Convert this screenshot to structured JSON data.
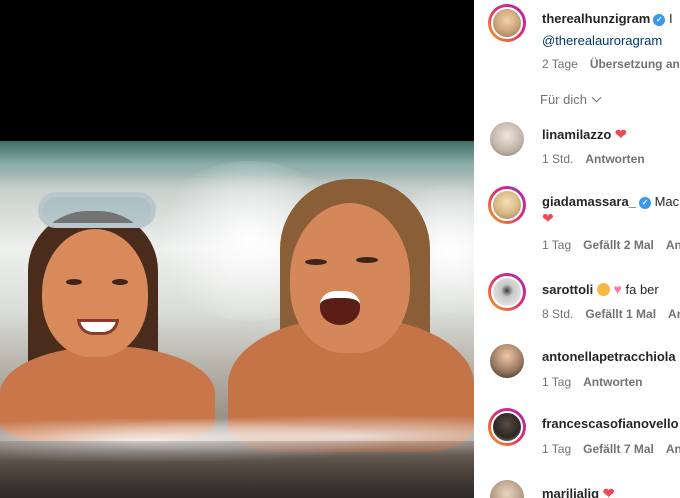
{
  "post": {
    "author": "therealhunzigram",
    "caption_cut": "I",
    "mention": "@therealauroragram",
    "time": "2 Tage",
    "translation": "Übersetzung anz"
  },
  "sort": {
    "label": "Für dich"
  },
  "comments": [
    {
      "username": "linamilazzo",
      "text": "",
      "heart": "❤",
      "time": "1 Std.",
      "likes": "",
      "reply": "Antworten"
    },
    {
      "username": "giadamassara_",
      "text": "Mac",
      "heart": "❤",
      "time": "1 Tag",
      "likes": "Gefällt 2 Mal",
      "reply": "An"
    },
    {
      "username": "sarottoli",
      "text": "fa ber",
      "heart": "",
      "time": "8 Std.",
      "likes": "Gefällt 1 Mal",
      "reply": "An"
    },
    {
      "username": "antonellapetracchiola",
      "text": "",
      "heart": "",
      "time": "1 Tag",
      "likes": "",
      "reply": "Antworten"
    },
    {
      "username": "francescasofianovello",
      "text": "",
      "heart": "",
      "time": "1 Tag",
      "likes": "Gefällt 7 Mal",
      "reply": "An"
    },
    {
      "username": "marilialig",
      "text": "",
      "heart": "❤",
      "time": "",
      "likes": "",
      "reply": ""
    }
  ],
  "colors": {
    "accent_link": "#00376b",
    "verified": "#3897f0",
    "heart": "#ed4956",
    "muted": "#737373"
  }
}
